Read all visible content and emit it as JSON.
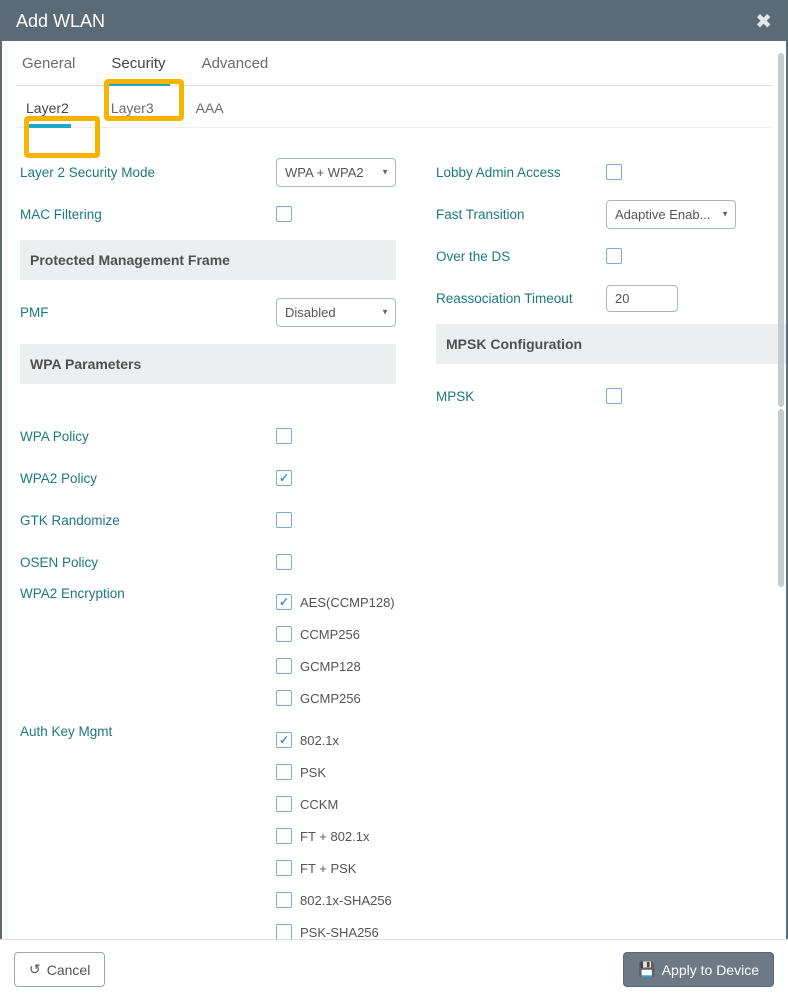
{
  "title": "Add WLAN",
  "mainTabs": {
    "general": "General",
    "security": "Security",
    "advanced": "Advanced"
  },
  "subTabs": {
    "layer2": "Layer2",
    "layer3": "Layer3",
    "aaa": "AAA"
  },
  "left": {
    "l2mode_label": "Layer 2 Security Mode",
    "l2mode_value": "WPA + WPA2",
    "macfilter_label": "MAC Filtering",
    "pmf_header": "Protected Management Frame",
    "pmf_label": "PMF",
    "pmf_value": "Disabled",
    "wpa_header": "WPA Parameters",
    "wpa_policy": "WPA Policy",
    "wpa2_policy": "WPA2 Policy",
    "gtk_rand": "GTK Randomize",
    "osen": "OSEN Policy",
    "wpa2_enc": "WPA2 Encryption",
    "enc_opts": {
      "aes": "AES(CCMP128)",
      "ccmp256": "CCMP256",
      "gcmp128": "GCMP128",
      "gcmp256": "GCMP256"
    },
    "akm": "Auth Key Mgmt",
    "akm_opts": {
      "dot1x": "802.1x",
      "psk": "PSK",
      "cckm": "CCKM",
      "ft_dot1x": "FT + 802.1x",
      "ft_psk": "FT + PSK",
      "dot1x_sha": "802.1x-SHA256",
      "psk_sha": "PSK-SHA256"
    }
  },
  "right": {
    "lobby": "Lobby Admin Access",
    "ft": "Fast Transition",
    "ft_value": "Adaptive Enab...",
    "overds": "Over the DS",
    "reassoc": "Reassociation Timeout",
    "reassoc_value": "20",
    "mpsk_header": "MPSK Configuration",
    "mpsk": "MPSK"
  },
  "footer": {
    "cancel": "Cancel",
    "apply": "Apply to Device"
  }
}
